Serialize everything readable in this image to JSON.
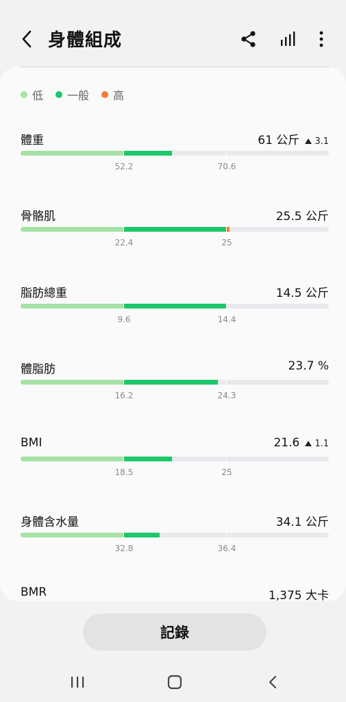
{
  "header": {
    "title": "身體組成"
  },
  "legend": [
    {
      "label": "低",
      "color": "#a6e2a6"
    },
    {
      "label": "一般",
      "color": "#1ec76b"
    },
    {
      "label": "高",
      "color": "#f47a3a"
    }
  ],
  "metrics": [
    {
      "name": "體重",
      "value": "61 公斤",
      "delta": "3.1",
      "low": "52.2",
      "high": "70.6",
      "level": 0.49,
      "over": 0
    },
    {
      "name": "骨骼肌",
      "value": "25.5 公斤",
      "delta": "",
      "low": "22.4",
      "high": "25",
      "level": 0.67,
      "over": 0.012
    },
    {
      "name": "脂肪總重",
      "value": "14.5 公斤",
      "delta": "",
      "low": "9.6",
      "high": "14.4",
      "level": 0.667,
      "over": 0
    },
    {
      "name": "體脂肪",
      "value": "23.7 %",
      "delta": "",
      "low": "16.2",
      "high": "24.3",
      "level": 0.64,
      "over": 0
    },
    {
      "name": "BMI",
      "value": "21.6",
      "delta": "1.1",
      "low": "18.5",
      "high": "25",
      "level": 0.49,
      "over": 0
    },
    {
      "name": "身體含水量",
      "value": "34.1 公斤",
      "delta": "",
      "low": "32.8",
      "high": "36.4",
      "level": 0.45,
      "over": 0
    },
    {
      "name": "BMR",
      "value": "1,375 大卡",
      "delta": ""
    }
  ],
  "actions": {
    "record_label": "記錄"
  },
  "colors": {
    "low": "#a6e2a6",
    "normal": "#1ec76b",
    "high": "#f47a3a",
    "track": "#e7e9ec"
  },
  "icons": {
    "back": "chevron-left-icon",
    "share": "share-icon",
    "chart": "bar-chart-icon",
    "more": "more-vert-icon",
    "nav_recent": "recent-apps-icon",
    "nav_home": "home-icon",
    "nav_back": "back-icon"
  }
}
